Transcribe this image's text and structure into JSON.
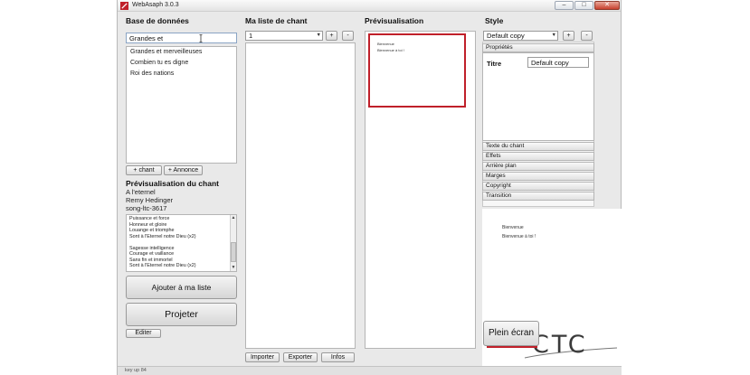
{
  "window": {
    "title": "WebAsaph 3.0.3",
    "minimize_glyph": "–",
    "maximize_glyph": "□",
    "close_glyph": "✕"
  },
  "database": {
    "heading": "Base de données",
    "search_value": "Grandes et",
    "results": [
      "Grandes et merveilleuses",
      "Combien tu es digne",
      "Roi des nations"
    ],
    "add_song_label": "+ chant",
    "add_announce_label": "+ Annonce"
  },
  "song_preview": {
    "heading": "Prévisualisation du chant",
    "title": "A l'eternel",
    "author": "Remy Hedinger",
    "id": "song-ltc-3617",
    "lyrics": [
      "Puissance et force",
      "Honneur et gloire",
      "Louange et triomphe",
      "Sont à l'Eternel notre Dieu (x2)",
      "",
      "Sagesse intelligence",
      "Courage et vaillance",
      "Sans fin et immortel",
      "Sont à l'Eternel notre Dieu (x2)"
    ]
  },
  "actions": {
    "add_to_list_label": "Ajouter à ma liste",
    "project_label": "Projeter",
    "edit_label": "Editer"
  },
  "setlist": {
    "heading": "Ma liste de chant",
    "selected": "1",
    "add_label": "+",
    "remove_label": "-",
    "import_label": "Importer",
    "export_label": "Exporter",
    "info_label": "Infos"
  },
  "preview": {
    "heading": "Prévisualisation",
    "line1": "Bienvenue",
    "line2": "Bienvenue à toi !"
  },
  "style": {
    "heading": "Style",
    "selected": "Default copy",
    "add_label": "+",
    "remove_label": "-",
    "properties_label": "Propriétés",
    "title_label": "Titre",
    "title_value": "Default copy",
    "sections": [
      "Texte du chant",
      "Effets",
      "Arrière plan",
      "Marges",
      "Copyright",
      "Transition"
    ]
  },
  "output_preview": {
    "line1": "Bienvenue",
    "line2": "Bienvenue à toi !"
  },
  "fullscreen_label": "Plein écran",
  "logo_text": "CTC",
  "status": "key up 84",
  "icons": {
    "dropdown": "▼",
    "scroll_up": "▲",
    "scroll_down": "▼"
  },
  "colors": {
    "accent_red": "#c0202a",
    "field_border": "#8aa4c4"
  }
}
